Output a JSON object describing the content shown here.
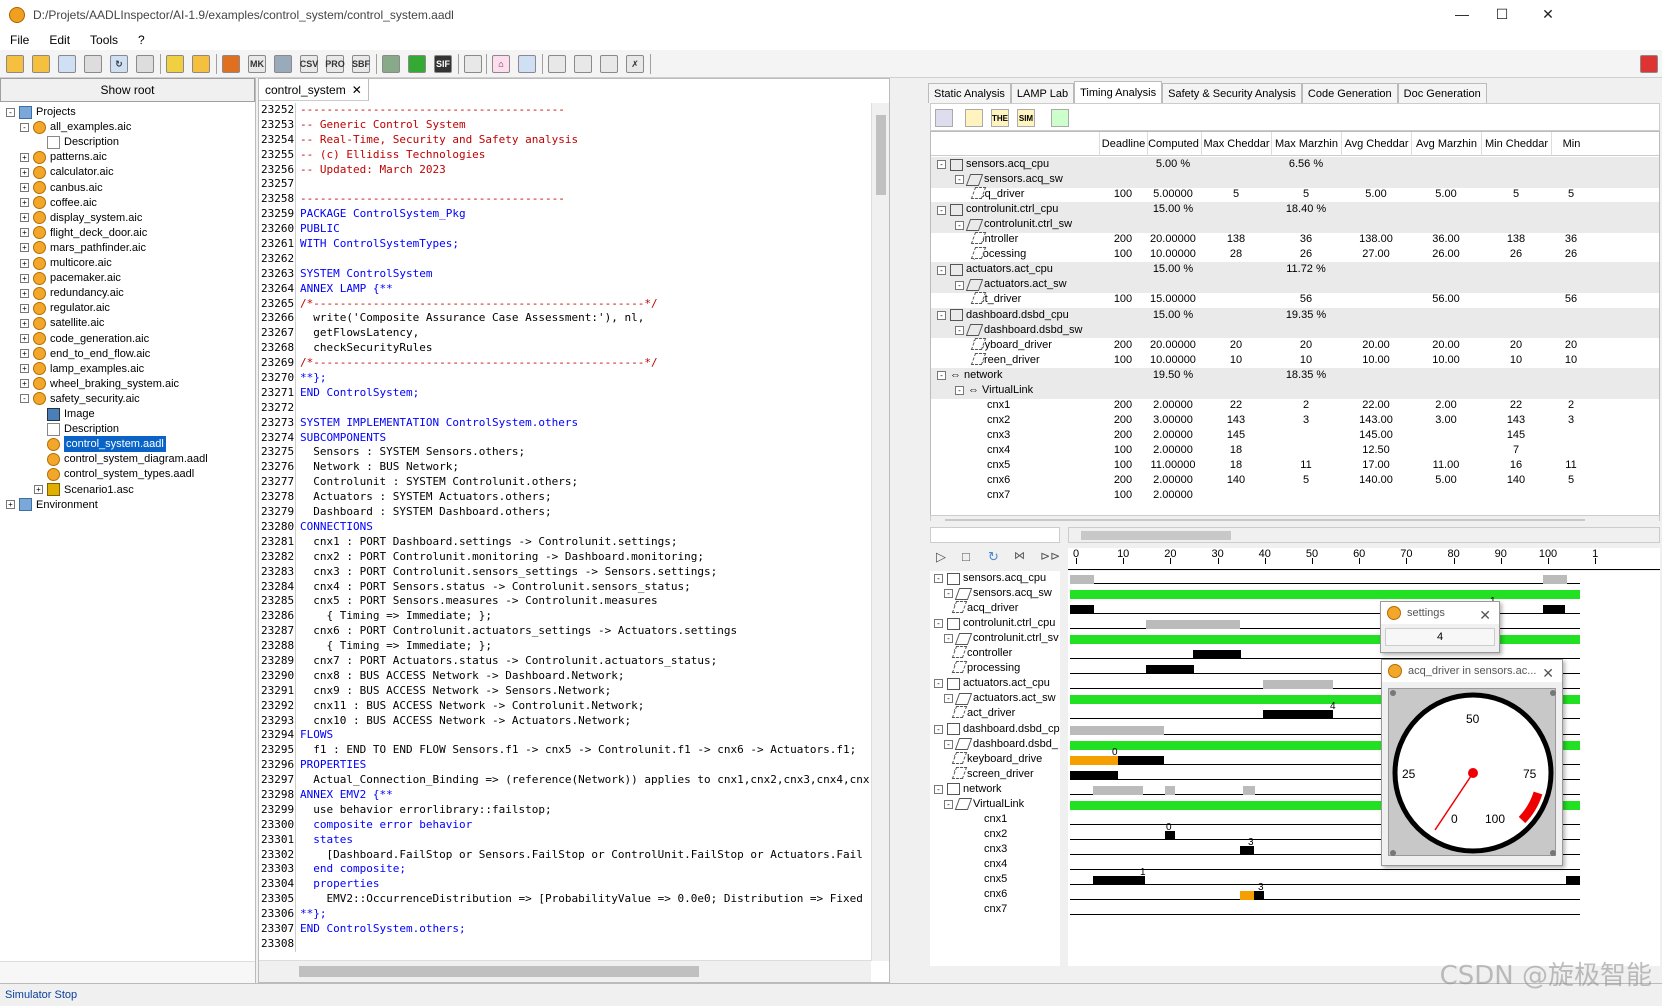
{
  "window": {
    "title": "D:/Projets/AADLInspector/AI-1.9/examples/control_system/control_system.aadl"
  },
  "menu": [
    "File",
    "Edit",
    "Tools",
    "?"
  ],
  "toolbar": {
    "csv": "CSV",
    "pro": "PRO",
    "sbf": "SBF",
    "sif": "SIF",
    "mk": "MK"
  },
  "left": {
    "show_root": "Show root",
    "tree": [
      {
        "label": "Projects",
        "level": 0,
        "icon": "folder",
        "exp": "-"
      },
      {
        "label": "all_examples.aic",
        "level": 1,
        "icon": "aic",
        "exp": "-"
      },
      {
        "label": "Description",
        "level": 2,
        "icon": "doc",
        "exp": ""
      },
      {
        "label": "patterns.aic",
        "level": 1,
        "icon": "aic",
        "exp": "+"
      },
      {
        "label": "calculator.aic",
        "level": 1,
        "icon": "aic",
        "exp": "+"
      },
      {
        "label": "canbus.aic",
        "level": 1,
        "icon": "aic",
        "exp": "+"
      },
      {
        "label": "coffee.aic",
        "level": 1,
        "icon": "aic",
        "exp": "+"
      },
      {
        "label": "display_system.aic",
        "level": 1,
        "icon": "aic",
        "exp": "+"
      },
      {
        "label": "flight_deck_door.aic",
        "level": 1,
        "icon": "aic",
        "exp": "+"
      },
      {
        "label": "mars_pathfinder.aic",
        "level": 1,
        "icon": "aic",
        "exp": "+"
      },
      {
        "label": "multicore.aic",
        "level": 1,
        "icon": "aic",
        "exp": "+"
      },
      {
        "label": "pacemaker.aic",
        "level": 1,
        "icon": "aic",
        "exp": "+"
      },
      {
        "label": "redundancy.aic",
        "level": 1,
        "icon": "aic",
        "exp": "+"
      },
      {
        "label": "regulator.aic",
        "level": 1,
        "icon": "aic",
        "exp": "+"
      },
      {
        "label": "satellite.aic",
        "level": 1,
        "icon": "aic",
        "exp": "+"
      },
      {
        "label": "code_generation.aic",
        "level": 1,
        "icon": "aic",
        "exp": "+"
      },
      {
        "label": "end_to_end_flow.aic",
        "level": 1,
        "icon": "aic",
        "exp": "+"
      },
      {
        "label": "lamp_examples.aic",
        "level": 1,
        "icon": "aic",
        "exp": "+"
      },
      {
        "label": "wheel_braking_system.aic",
        "level": 1,
        "icon": "aic",
        "exp": "+"
      },
      {
        "label": "safety_security.aic",
        "level": 1,
        "icon": "aic",
        "exp": "-"
      },
      {
        "label": "Image",
        "level": 2,
        "icon": "img",
        "exp": ""
      },
      {
        "label": "Description",
        "level": 2,
        "icon": "doc",
        "exp": ""
      },
      {
        "label": "control_system.aadl",
        "level": 2,
        "icon": "aic",
        "exp": "",
        "selected": true
      },
      {
        "label": "control_system_diagram.aadl",
        "level": 2,
        "icon": "aic",
        "exp": ""
      },
      {
        "label": "control_system_types.aadl",
        "level": 2,
        "icon": "aic",
        "exp": ""
      },
      {
        "label": "Scenario1.asc",
        "level": 2,
        "icon": "scn",
        "exp": "+"
      },
      {
        "label": "Environment",
        "level": 0,
        "icon": "folder",
        "exp": "+"
      }
    ]
  },
  "editor": {
    "tab": "control_system",
    "close": "✕",
    "lines": [
      {
        "n": "23252",
        "t": "----------------------------------------",
        "c": "cm"
      },
      {
        "n": "23253",
        "t": "-- Generic Control System",
        "c": "cm"
      },
      {
        "n": "23254",
        "t": "-- Real-Time, Security and Safety analysis",
        "c": "cm"
      },
      {
        "n": "23255",
        "t": "-- (c) Ellidiss Technologies",
        "c": "cm"
      },
      {
        "n": "23256",
        "t": "-- Updated: March 2023",
        "c": "cm"
      },
      {
        "n": "23257",
        "t": "",
        "c": ""
      },
      {
        "n": "23258",
        "t": "----------------------------------------",
        "c": "cm"
      },
      {
        "n": "23259",
        "t": "PACKAGE ControlSystem_Pkg",
        "c": "kwstart"
      },
      {
        "n": "23260",
        "t": "PUBLIC",
        "c": "kw"
      },
      {
        "n": "23261",
        "t": "WITH ControlSystemTypes;",
        "c": "kwstart"
      },
      {
        "n": "23262",
        "t": "",
        "c": ""
      },
      {
        "n": "23263",
        "t": "SYSTEM ControlSystem",
        "c": "kwstart"
      },
      {
        "n": "23264",
        "t": "ANNEX LAMP {**",
        "c": "kwstart"
      },
      {
        "n": "23265",
        "t": "/*--------------------------------------------------*/",
        "c": "cm"
      },
      {
        "n": "23266",
        "t": "  write('Composite Assurance Case Assessment:'), nl,",
        "c": ""
      },
      {
        "n": "23267",
        "t": "  getFlowsLatency,",
        "c": ""
      },
      {
        "n": "23268",
        "t": "  checkSecurityRules",
        "c": ""
      },
      {
        "n": "23269",
        "t": "/*--------------------------------------------------*/",
        "c": "cm"
      },
      {
        "n": "23270",
        "t": "**};",
        "c": "kw"
      },
      {
        "n": "23271",
        "t": "END ControlSystem;",
        "c": "kwstart"
      },
      {
        "n": "23272",
        "t": "",
        "c": ""
      },
      {
        "n": "23273",
        "t": "SYSTEM IMPLEMENTATION ControlSystem.others",
        "c": "kwstart"
      },
      {
        "n": "23274",
        "t": "SUBCOMPONENTS",
        "c": "kw"
      },
      {
        "n": "23275",
        "t": "  Sensors : SYSTEM Sensors.others;",
        "c": ""
      },
      {
        "n": "23276",
        "t": "  Network : BUS Network;",
        "c": ""
      },
      {
        "n": "23277",
        "t": "  Controlunit : SYSTEM Controlunit.others;",
        "c": ""
      },
      {
        "n": "23278",
        "t": "  Actuators : SYSTEM Actuators.others;",
        "c": ""
      },
      {
        "n": "23279",
        "t": "  Dashboard : SYSTEM Dashboard.others;",
        "c": ""
      },
      {
        "n": "23280",
        "t": "CONNECTIONS",
        "c": "kw"
      },
      {
        "n": "23281",
        "t": "  cnx1 : PORT Dashboard.settings -> Controlunit.settings;",
        "c": ""
      },
      {
        "n": "23282",
        "t": "  cnx2 : PORT Controlunit.monitoring -> Dashboard.monitoring;",
        "c": ""
      },
      {
        "n": "23283",
        "t": "  cnx3 : PORT Controlunit.sensors_settings -> Sensors.settings;",
        "c": ""
      },
      {
        "n": "23284",
        "t": "  cnx4 : PORT Sensors.status -> Controlunit.sensors_status;",
        "c": ""
      },
      {
        "n": "23285",
        "t": "  cnx5 : PORT Sensors.measures -> Controlunit.measures",
        "c": ""
      },
      {
        "n": "23286",
        "t": "    { Timing => Immediate; };",
        "c": ""
      },
      {
        "n": "23287",
        "t": "  cnx6 : PORT Controlunit.actuators_settings -> Actuators.settings",
        "c": ""
      },
      {
        "n": "23288",
        "t": "    { Timing => Immediate; };",
        "c": ""
      },
      {
        "n": "23289",
        "t": "  cnx7 : PORT Actuators.status -> Controlunit.actuators_status;",
        "c": ""
      },
      {
        "n": "23290",
        "t": "  cnx8 : BUS ACCESS Network -> Dashboard.Network;",
        "c": ""
      },
      {
        "n": "23291",
        "t": "  cnx9 : BUS ACCESS Network -> Sensors.Network;",
        "c": ""
      },
      {
        "n": "23292",
        "t": "  cnx11 : BUS ACCESS Network -> Controlunit.Network;",
        "c": ""
      },
      {
        "n": "23293",
        "t": "  cnx10 : BUS ACCESS Network -> Actuators.Network;",
        "c": ""
      },
      {
        "n": "23294",
        "t": "FLOWS",
        "c": "kw"
      },
      {
        "n": "23295",
        "t": "  f1 : END TO END FLOW Sensors.f1 -> cnx5 -> Controlunit.f1 -> cnx6 -> Actuators.f1;",
        "c": ""
      },
      {
        "n": "23296",
        "t": "PROPERTIES",
        "c": "kw"
      },
      {
        "n": "23297",
        "t": "  Actual_Connection_Binding => (reference(Network)) applies to cnx1,cnx2,cnx3,cnx4,cnx",
        "c": ""
      },
      {
        "n": "23298",
        "t": "ANNEX EMV2 {**",
        "c": "kwstart"
      },
      {
        "n": "23299",
        "t": "  use behavior errorlibrary::failstop;",
        "c": ""
      },
      {
        "n": "23300",
        "t": "  composite error behavior",
        "c": "kw"
      },
      {
        "n": "23301",
        "t": "  states",
        "c": "kw"
      },
      {
        "n": "23302",
        "t": "    [Dashboard.FailStop or Sensors.FailStop or ControlUnit.FailStop or Actuators.Fail",
        "c": ""
      },
      {
        "n": "23303",
        "t": "  end composite;",
        "c": "kw"
      },
      {
        "n": "23304",
        "t": "  properties",
        "c": "kw"
      },
      {
        "n": "23305",
        "t": "    EMV2::OccurrenceDistribution => [ProbabilityValue => 0.0e0; Distribution => Fixed",
        "c": ""
      },
      {
        "n": "23306",
        "t": "**};",
        "c": "kw"
      },
      {
        "n": "23307",
        "t": "END ControlSystem.others;",
        "c": "kwstart"
      },
      {
        "n": "23308",
        "t": "",
        "c": ""
      }
    ]
  },
  "right": {
    "tabs": [
      "Static Analysis",
      "LAMP Lab",
      "Timing Analysis",
      "Safety & Security Analysis",
      "Code Generation",
      "Doc Generation"
    ],
    "active_tab": 2,
    "tool_labels": {
      "the": "THE",
      "sim": "SIM"
    },
    "columns": [
      "Deadline",
      "Computed",
      "Max Cheddar",
      "Max Marzhin",
      "Avg Cheddar",
      "Avg Marzhin",
      "Min Cheddar",
      "Min Marz"
    ],
    "rows": [
      {
        "name": "sensors.acq_cpu",
        "lvl": 0,
        "icon": "cpu",
        "grey": true,
        "exp": "-",
        "v": [
          "",
          "5.00 %",
          "",
          "6.56 %",
          "",
          "",
          "",
          ""
        ]
      },
      {
        "name": "sensors.acq_sw",
        "lvl": 1,
        "icon": "sw",
        "grey": true,
        "exp": "-",
        "v": [
          "",
          "",
          "",
          "",
          "",
          "",
          "",
          ""
        ]
      },
      {
        "name": "acq_driver",
        "lvl": 2,
        "icon": "thr",
        "grey": false,
        "exp": "",
        "v": [
          "100",
          "5.00000",
          "5",
          "5",
          "5.00",
          "5.00",
          "5",
          "5"
        ]
      },
      {
        "name": "controlunit.ctrl_cpu",
        "lvl": 0,
        "icon": "cpu",
        "grey": true,
        "exp": "-",
        "v": [
          "",
          "15.00 %",
          "",
          "18.40 %",
          "",
          "",
          "",
          ""
        ]
      },
      {
        "name": "controlunit.ctrl_sw",
        "lvl": 1,
        "icon": "sw",
        "grey": true,
        "exp": "-",
        "v": [
          "",
          "",
          "",
          "",
          "",
          "",
          "",
          ""
        ]
      },
      {
        "name": "controller",
        "lvl": 2,
        "icon": "thr",
        "grey": false,
        "exp": "",
        "v": [
          "200",
          "20.00000",
          "138",
          "36",
          "138.00",
          "36.00",
          "138",
          "36"
        ]
      },
      {
        "name": "processing",
        "lvl": 2,
        "icon": "thr",
        "grey": false,
        "exp": "",
        "v": [
          "100",
          "10.00000",
          "28",
          "26",
          "27.00",
          "26.00",
          "26",
          "26"
        ]
      },
      {
        "name": "actuators.act_cpu",
        "lvl": 0,
        "icon": "cpu",
        "grey": true,
        "exp": "-",
        "v": [
          "",
          "15.00 %",
          "",
          "11.72 %",
          "",
          "",
          "",
          ""
        ]
      },
      {
        "name": "actuators.act_sw",
        "lvl": 1,
        "icon": "sw",
        "grey": true,
        "exp": "-",
        "v": [
          "",
          "",
          "",
          "",
          "",
          "",
          "",
          ""
        ]
      },
      {
        "name": "act_driver",
        "lvl": 2,
        "icon": "thr",
        "grey": false,
        "exp": "",
        "v": [
          "100",
          "15.00000",
          "",
          "56",
          "",
          "56.00",
          "",
          "56"
        ]
      },
      {
        "name": "dashboard.dsbd_cpu",
        "lvl": 0,
        "icon": "cpu",
        "grey": true,
        "exp": "-",
        "v": [
          "",
          "15.00 %",
          "",
          "19.35 %",
          "",
          "",
          "",
          ""
        ]
      },
      {
        "name": "dashboard.dsbd_sw",
        "lvl": 1,
        "icon": "sw",
        "grey": true,
        "exp": "-",
        "v": [
          "",
          "",
          "",
          "",
          "",
          "",
          "",
          ""
        ]
      },
      {
        "name": "keyboard_driver",
        "lvl": 2,
        "icon": "thr",
        "grey": false,
        "exp": "",
        "v": [
          "200",
          "20.00000",
          "20",
          "20",
          "20.00",
          "20.00",
          "20",
          "20"
        ]
      },
      {
        "name": "screen_driver",
        "lvl": 2,
        "icon": "thr",
        "grey": false,
        "exp": "",
        "v": [
          "100",
          "10.00000",
          "10",
          "10",
          "10.00",
          "10.00",
          "10",
          "10"
        ]
      },
      {
        "name": "network",
        "lvl": 0,
        "icon": "net",
        "grey": true,
        "exp": "-",
        "v": [
          "",
          "19.50 %",
          "",
          "18.35 %",
          "",
          "",
          "",
          ""
        ]
      },
      {
        "name": "VirtualLink",
        "lvl": 1,
        "icon": "net",
        "grey": true,
        "exp": "-",
        "v": [
          "",
          "",
          "",
          "",
          "",
          "",
          "",
          ""
        ]
      },
      {
        "name": "cnx1",
        "lvl": 2,
        "icon": "",
        "grey": false,
        "exp": "",
        "v": [
          "200",
          "2.00000",
          "22",
          "2",
          "22.00",
          "2.00",
          "22",
          "2"
        ]
      },
      {
        "name": "cnx2",
        "lvl": 2,
        "icon": "",
        "grey": false,
        "exp": "",
        "v": [
          "200",
          "3.00000",
          "143",
          "3",
          "143.00",
          "3.00",
          "143",
          "3"
        ]
      },
      {
        "name": "cnx3",
        "lvl": 2,
        "icon": "",
        "grey": false,
        "exp": "",
        "v": [
          "200",
          "2.00000",
          "145",
          "",
          "145.00",
          "",
          "145",
          ""
        ]
      },
      {
        "name": "cnx4",
        "lvl": 2,
        "icon": "",
        "grey": false,
        "exp": "",
        "v": [
          "100",
          "2.00000",
          "18",
          "",
          "12.50",
          "",
          "7",
          ""
        ]
      },
      {
        "name": "cnx5",
        "lvl": 2,
        "icon": "",
        "grey": false,
        "exp": "",
        "v": [
          "100",
          "11.00000",
          "18",
          "11",
          "17.00",
          "11.00",
          "16",
          "11"
        ]
      },
      {
        "name": "cnx6",
        "lvl": 2,
        "icon": "",
        "grey": false,
        "exp": "",
        "v": [
          "200",
          "2.00000",
          "140",
          "5",
          "140.00",
          "5.00",
          "140",
          "5"
        ]
      },
      {
        "name": "cnx7",
        "lvl": 2,
        "icon": "",
        "grey": false,
        "exp": "",
        "v": [
          "100",
          "2.00000",
          "",
          "",
          "",
          "",
          "",
          ""
        ]
      }
    ]
  },
  "simulator": {
    "tree": [
      {
        "name": "sensors.acq_cpu",
        "lvl": 0
      },
      {
        "name": "sensors.acq_sw",
        "lvl": 1
      },
      {
        "name": "acq_driver",
        "lvl": 2
      },
      {
        "name": "controlunit.ctrl_cpu",
        "lvl": 0
      },
      {
        "name": "controlunit.ctrl_sv",
        "lvl": 1
      },
      {
        "name": "controller",
        "lvl": 2
      },
      {
        "name": "processing",
        "lvl": 2
      },
      {
        "name": "actuators.act_cpu",
        "lvl": 0
      },
      {
        "name": "actuators.act_sw",
        "lvl": 1
      },
      {
        "name": "act_driver",
        "lvl": 2
      },
      {
        "name": "dashboard.dsbd_cp",
        "lvl": 0
      },
      {
        "name": "dashboard.dsbd_",
        "lvl": 1
      },
      {
        "name": "keyboard_drive",
        "lvl": 2
      },
      {
        "name": "screen_driver",
        "lvl": 2
      },
      {
        "name": "network",
        "lvl": 0
      },
      {
        "name": "VirtualLink",
        "lvl": 1
      },
      {
        "name": "cnx1",
        "lvl": 3
      },
      {
        "name": "cnx2",
        "lvl": 3
      },
      {
        "name": "cnx3",
        "lvl": 3
      },
      {
        "name": "cnx4",
        "lvl": 3
      },
      {
        "name": "cnx5",
        "lvl": 3
      },
      {
        "name": "cnx6",
        "lvl": 3
      },
      {
        "name": "cnx7",
        "lvl": 3
      }
    ],
    "axis_ticks": [
      "0",
      "10",
      "20",
      "30",
      "40",
      "50",
      "60",
      "70",
      "80",
      "90",
      "100",
      "1"
    ],
    "bar_labels": {
      "acq": "1",
      "act": "4",
      "kbd": "0",
      "cnx2": "0",
      "cnx3": "3",
      "cnx5": "1",
      "cnx6": "3"
    },
    "settings_popup": {
      "title": "settings",
      "value": "4"
    },
    "gauge_popup": {
      "title": "acq_driver in sensors.ac...",
      "labels": [
        "0",
        "25",
        "50",
        "75",
        "100"
      ]
    }
  },
  "status": "Simulator Stop",
  "watermark": "CSDN @旋极智能"
}
